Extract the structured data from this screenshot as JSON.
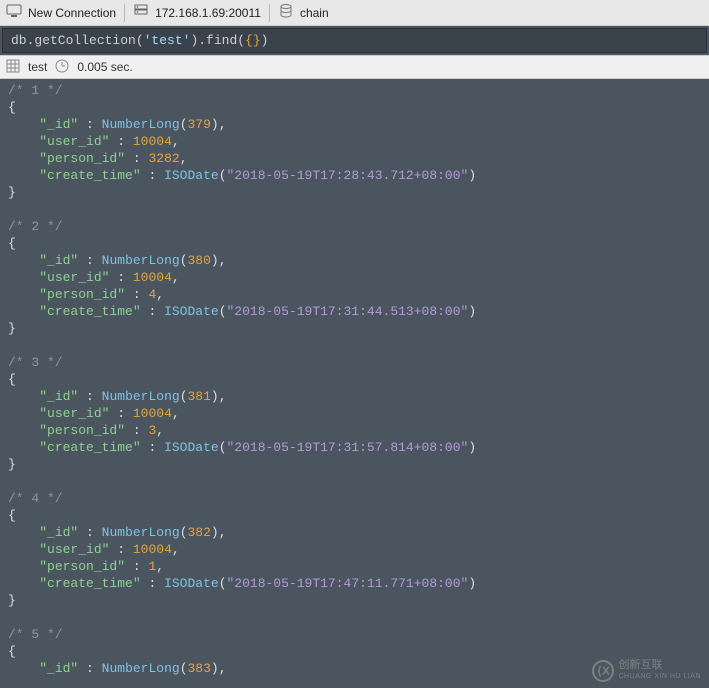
{
  "toolbar": {
    "connection_label": "New Connection",
    "host_label": "172.168.1.69:20011",
    "db_label": "chain"
  },
  "query": {
    "prefix": "db.getCollection(",
    "arg": "'test'",
    "suffix": ").find(",
    "braces": "{}",
    "close": ")"
  },
  "status": {
    "collection": "test",
    "time": "0.005 sec."
  },
  "docs": [
    {
      "_id": 379,
      "user_id": 10004,
      "person_id": 3282,
      "create_time": "2018-05-19T17:28:43.712+08:00"
    },
    {
      "_id": 380,
      "user_id": 10004,
      "person_id": 4,
      "create_time": "2018-05-19T17:31:44.513+08:00"
    },
    {
      "_id": 381,
      "user_id": 10004,
      "person_id": 3,
      "create_time": "2018-05-19T17:31:57.814+08:00"
    },
    {
      "_id": 382,
      "user_id": 10004,
      "person_id": 1,
      "create_time": "2018-05-19T17:47:11.771+08:00"
    },
    {
      "_id": 383
    }
  ],
  "watermark": {
    "line1": "创新互联",
    "line2": "CHUANG XIN HU LIAN"
  }
}
